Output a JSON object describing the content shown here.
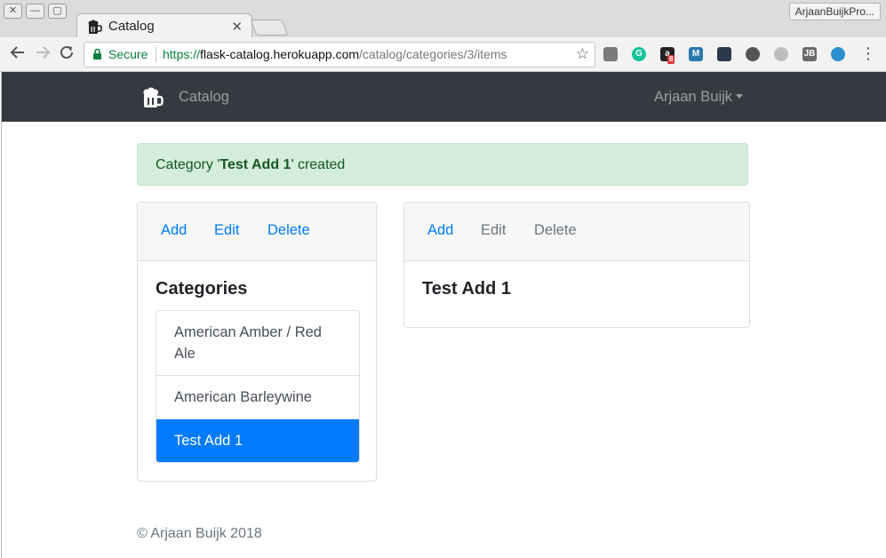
{
  "browser": {
    "tab_title": "Catalog",
    "tab_close": "✕",
    "profile_name": "ArjaanBuijkPro...",
    "omnibox": {
      "secure_label": "Secure",
      "url_scheme": "https://",
      "url_host": "flask-catalog.herokuapp.com",
      "url_path": "/catalog/categories/3/items"
    },
    "extensions": [
      {
        "name": "extension-grey-icon",
        "label": "",
        "color": "#7a7a7a"
      },
      {
        "name": "grammarly-icon",
        "label": "G",
        "color": "#15c39a"
      },
      {
        "name": "amazon-assistant-icon",
        "label": "a",
        "color": "#222222",
        "badge": "8"
      },
      {
        "name": "m-extension-icon",
        "label": "M",
        "color": "#2a7ab0"
      },
      {
        "name": "dark-extension-icon",
        "label": "",
        "color": "#2b3a4a"
      },
      {
        "name": "eye-icon",
        "label": "",
        "color": "#555555"
      },
      {
        "name": "cube-icon",
        "label": "",
        "color": "#bdbdbd"
      },
      {
        "name": "jb-icon",
        "label": "JB",
        "color": "#6a6a6a"
      },
      {
        "name": "shield-extension-icon",
        "label": "",
        "color": "#2a8fd0"
      }
    ]
  },
  "site": {
    "brand": "Catalog",
    "user_name": "Arjaan Buijk"
  },
  "alert": {
    "prefix": "Category '",
    "bold": "Test Add 1",
    "suffix": "' created",
    "color": "#155724"
  },
  "categories_card": {
    "actions": [
      "Add",
      "Edit",
      "Delete"
    ],
    "title": "Categories",
    "items": [
      {
        "label": "American Amber / Red Ale",
        "active": false
      },
      {
        "label": "American Barleywine",
        "active": false
      },
      {
        "label": "Test Add 1",
        "active": true
      }
    ]
  },
  "items_card": {
    "actions": [
      "Add",
      "Edit",
      "Delete"
    ],
    "title": "Test Add 1"
  },
  "footer": {
    "text": "© Arjaan Buijk 2018"
  },
  "colors": {
    "primary": "#007bff",
    "navbar": "#343a40",
    "alert_bg": "#d4edda"
  }
}
